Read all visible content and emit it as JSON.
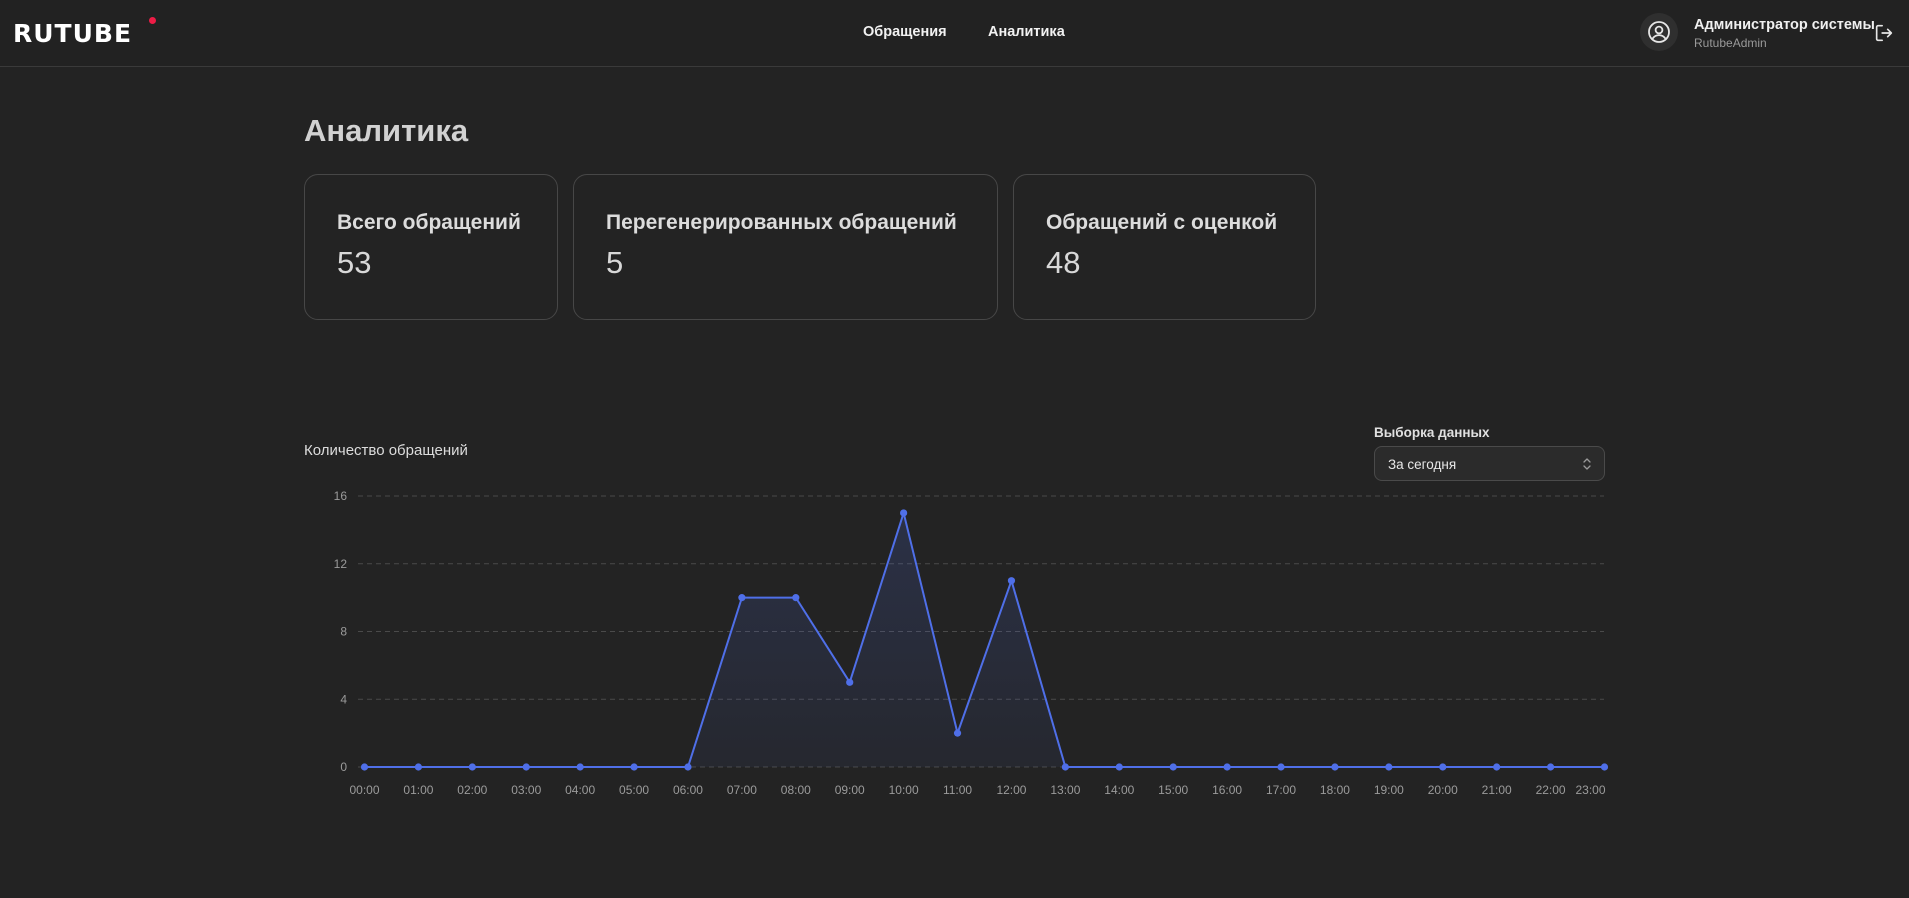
{
  "header": {
    "logo": "RUTUBE",
    "nav": [
      "Обращения",
      "Аналитика"
    ],
    "user": {
      "name": "Администратор системы",
      "login": "RutubeAdmin"
    },
    "icons": [
      "user-circle-icon",
      "logout-icon"
    ]
  },
  "page": {
    "title": "Аналитика"
  },
  "stats": [
    {
      "label": "Всего обращений",
      "value": "53"
    },
    {
      "label": "Перегенерированных обращений",
      "value": "5"
    },
    {
      "label": "Обращений с оценкой",
      "value": "48"
    }
  ],
  "chart": {
    "title": "Количество обращений",
    "select_label": "Выборка данных",
    "select_value": "За сегодня"
  },
  "colors": {
    "accent": "#4f6fe8",
    "brand_dot": "#ed1c46",
    "background": "#232323"
  },
  "chart_data": {
    "type": "area",
    "categories": [
      "00:00",
      "01:00",
      "02:00",
      "03:00",
      "04:00",
      "05:00",
      "06:00",
      "07:00",
      "08:00",
      "09:00",
      "10:00",
      "11:00",
      "12:00",
      "13:00",
      "14:00",
      "15:00",
      "16:00",
      "17:00",
      "18:00",
      "19:00",
      "20:00",
      "21:00",
      "22:00",
      "23:00"
    ],
    "values": [
      0,
      0,
      0,
      0,
      0,
      0,
      0,
      10,
      10,
      5,
      15,
      2,
      11,
      0,
      0,
      0,
      0,
      0,
      0,
      0,
      0,
      0,
      0,
      0
    ],
    "yticks": [
      0,
      4,
      8,
      12,
      16
    ],
    "ylim": [
      0,
      16
    ],
    "grid": true,
    "legend": "none"
  }
}
